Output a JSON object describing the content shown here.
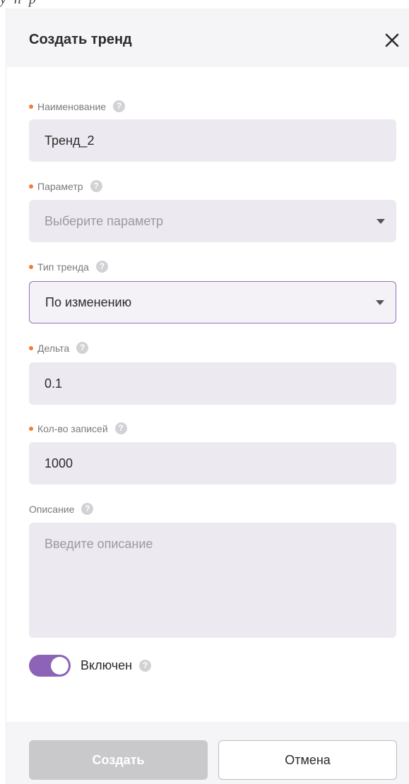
{
  "top_fragment": "у п р",
  "dialog": {
    "title": "Создать тренд"
  },
  "fields": {
    "name": {
      "label": "Наименование",
      "value": "Тренд_2"
    },
    "parameter": {
      "label": "Параметр",
      "placeholder": "Выберите параметр"
    },
    "trend_type": {
      "label": "Тип тренда",
      "value": "По изменению"
    },
    "delta": {
      "label": "Дельта",
      "value": "0.1"
    },
    "records_count": {
      "label": "Кол-во записей",
      "value": "1000"
    },
    "description": {
      "label": "Описание",
      "placeholder": "Введите описание"
    }
  },
  "toggle": {
    "label": "Включен",
    "state": "on"
  },
  "help_glyph": "?",
  "buttons": {
    "create": "Создать",
    "cancel": "Отмена"
  },
  "colors": {
    "accent": "#8c63b7",
    "required_dot": "#f07d3a",
    "input_bg": "#eceaf0",
    "header_bg": "#f5f5f7"
  },
  "icons": {
    "close": "close-icon",
    "help": "help-icon",
    "caret": "chevron-down-icon"
  }
}
